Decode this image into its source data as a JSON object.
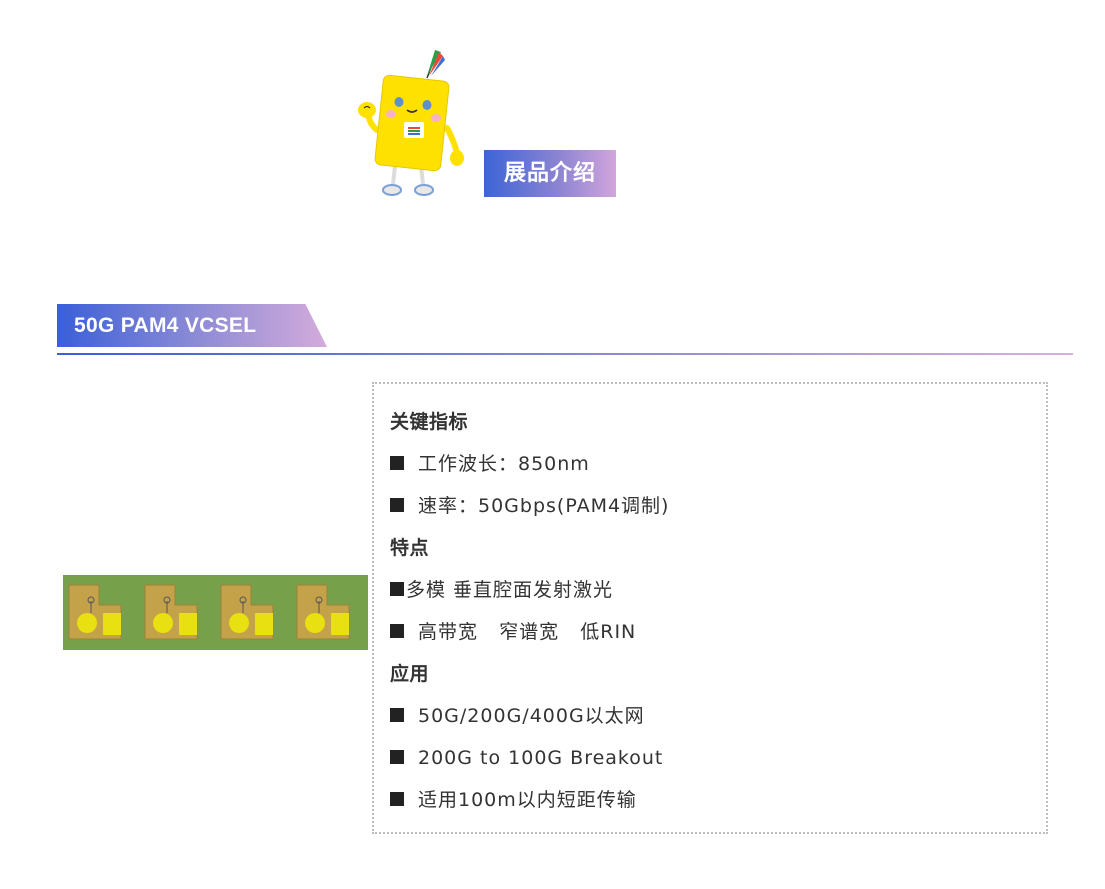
{
  "exhibit_badge": {
    "label": "展品介绍"
  },
  "section": {
    "title": "50G PAM4 VCSEL"
  },
  "specs": {
    "key_metrics": {
      "heading": "关键指标",
      "items": [
        "工作波长：850nm",
        "速率：50Gbps(PAM4调制)"
      ]
    },
    "features": {
      "heading": "特点",
      "items": [
        "多模 垂直腔面发射激光",
        "高带宽   窄谱宽   低RIN"
      ]
    },
    "applications": {
      "heading": "应用",
      "items": [
        "50G/200G/400G以太网",
        "200G to 100G Breakout",
        "适用100m以内短距传输"
      ]
    }
  },
  "colors": {
    "accent_blue": "#3a5fd8",
    "accent_pink": "#d4abdb",
    "chip_substrate": "#76a04a",
    "chip_pad": "#c4a24a",
    "mascot_yellow": "#ffe100"
  },
  "icons": {
    "mascot": "mascot-illustration",
    "chip": "vcsel-chip-array-photo",
    "bullet": "square-bullet-icon"
  }
}
